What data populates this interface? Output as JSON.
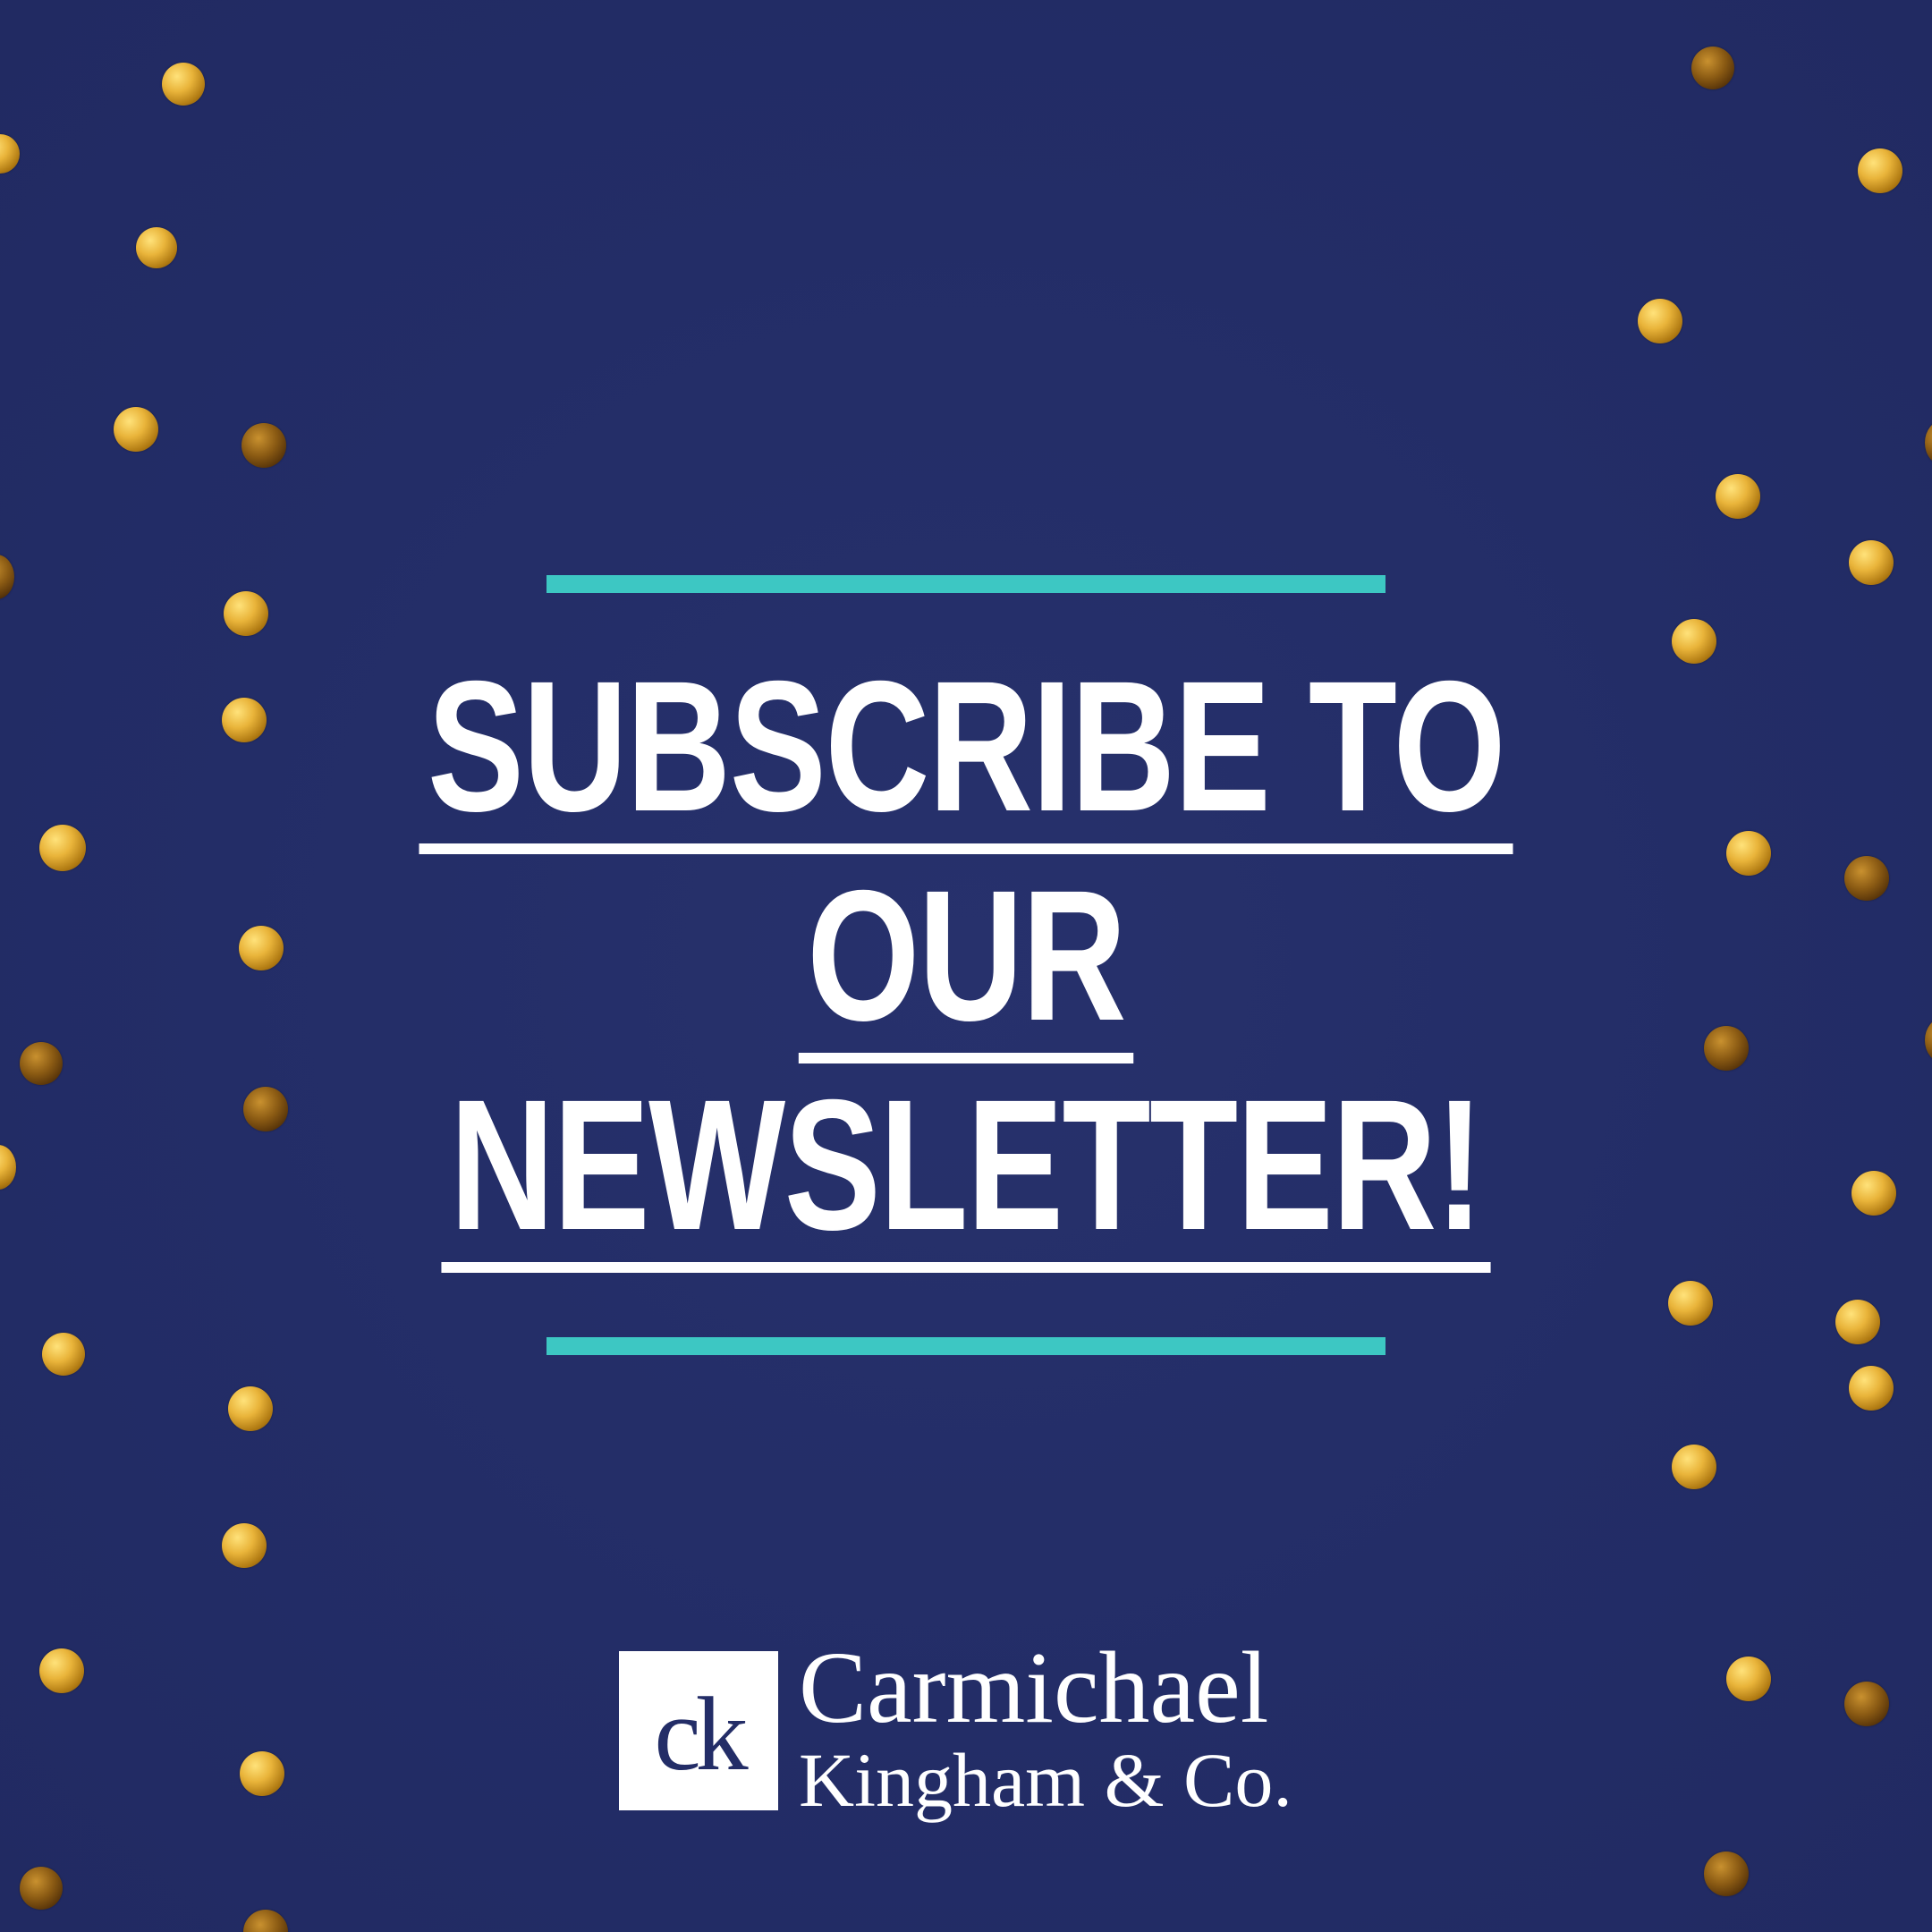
{
  "headline": {
    "line1": "SUBSCRIBE TO",
    "line2": "OUR",
    "line3": "NEWSLETTER!"
  },
  "brand": {
    "monogram": "ck",
    "name_line1": "Carmichael",
    "name_line2": "Kingham & Co."
  },
  "colors": {
    "background": "#232d67",
    "accent_rule": "#3dc7c3",
    "confetti_gold": "#e9b43a",
    "text": "#ffffff"
  }
}
